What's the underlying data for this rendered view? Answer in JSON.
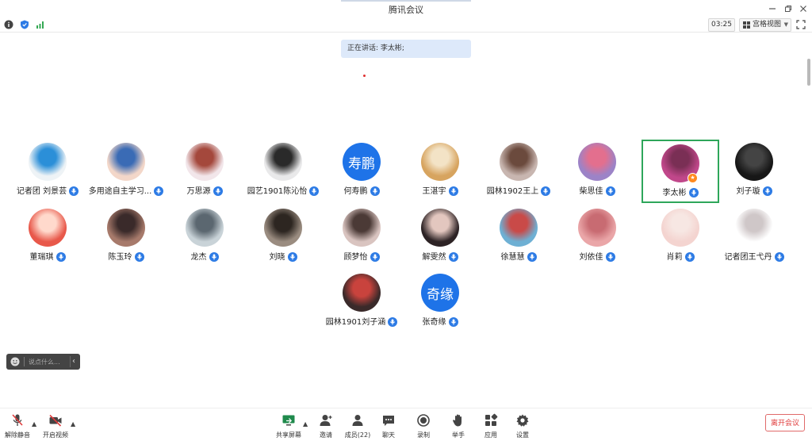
{
  "window": {
    "title": "腾讯会议"
  },
  "status": {
    "timer": "03:25",
    "view_mode": "宫格视图"
  },
  "speaking_banner": "正在讲话: 李太彬;",
  "participants": [
    {
      "name": "记者团 刘景芸",
      "avatar": "photo"
    },
    {
      "name": "多用途自主学习...",
      "avatar": "photo"
    },
    {
      "name": "万思源",
      "avatar": "photo"
    },
    {
      "name": "园艺1901陈沁怡",
      "avatar": "photo"
    },
    {
      "name": "何寿鹏",
      "avatar": "text",
      "avatar_text": "寿鹏"
    },
    {
      "name": "王湛宇",
      "avatar": "photo"
    },
    {
      "name": "园林1902王上",
      "avatar": "photo"
    },
    {
      "name": "柴思佳",
      "avatar": "photo"
    },
    {
      "name": "李太彬",
      "avatar": "photo",
      "active": true
    },
    {
      "name": "刘子璇",
      "avatar": "photo"
    },
    {
      "name": "董瑞琪",
      "avatar": "photo"
    },
    {
      "name": "陈玉玲",
      "avatar": "photo"
    },
    {
      "name": "龙杰",
      "avatar": "photo"
    },
    {
      "name": "刘晓",
      "avatar": "photo"
    },
    {
      "name": "顾梦怡",
      "avatar": "photo"
    },
    {
      "name": "解雯然",
      "avatar": "photo"
    },
    {
      "name": "徐慧慧",
      "avatar": "photo"
    },
    {
      "name": "刘依佳",
      "avatar": "photo"
    },
    {
      "name": "肖莉",
      "avatar": "photo"
    },
    {
      "name": "记者团王弋丹",
      "avatar": "photo"
    },
    {
      "name": "园林1901刘子涵",
      "avatar": "photo"
    },
    {
      "name": "张奇缘",
      "avatar": "text",
      "avatar_text": "奇缘"
    }
  ],
  "chat": {
    "placeholder": "说点什么..."
  },
  "toolbar": {
    "unmute": "解除静音",
    "start_video": "开启视频",
    "share_screen": "共享屏幕",
    "invite": "邀请",
    "members": "成员(22)",
    "chat": "聊天",
    "record": "录制",
    "raise_hand": "举手",
    "apps": "应用",
    "settings": "设置",
    "leave": "离开会议"
  },
  "colors": {
    "accent": "#1e73e8",
    "active_border": "#2ea65a",
    "leave_red": "#e03c3c",
    "speaking_bg": "#dde9fa"
  }
}
